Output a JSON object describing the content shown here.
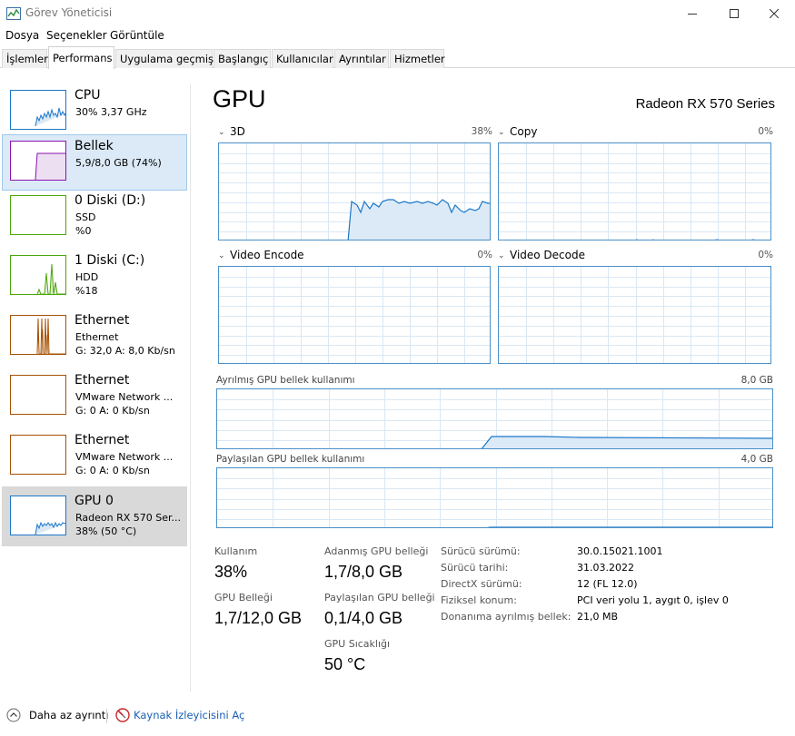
{
  "window": {
    "title": "Görev Yöneticisi"
  },
  "menu": [
    "Dosya",
    "Seçenekler",
    "Görüntüle"
  ],
  "tabs": [
    "İşlemler",
    "Performans",
    "Uygulama geçmişi",
    "Başlangıç",
    "Kullanıcılar",
    "Ayrıntılar",
    "Hizmetler"
  ],
  "sidebar": [
    {
      "name": "CPU",
      "line2": "30% 3,37 GHz",
      "line3": "",
      "color": "#1a77c9"
    },
    {
      "name": "Bellek",
      "line2": "5,9/8,0 GB (74%)",
      "line3": "",
      "color": "#8b12ae"
    },
    {
      "name": "0 Diski (D:)",
      "line2": "SSD",
      "line3": "%0",
      "color": "#4da60c"
    },
    {
      "name": "1 Diski (C:)",
      "line2": "HDD",
      "line3": "%18",
      "color": "#4da60c"
    },
    {
      "name": "Ethernet",
      "line2": "Ethernet",
      "line3": "G: 32,0  A: 8,0 Kb/sn",
      "color": "#a74f01"
    },
    {
      "name": "Ethernet",
      "line2": "VMware Network ...",
      "line3": "G: 0  A: 0 Kb/sn",
      "color": "#a74f01"
    },
    {
      "name": "Ethernet",
      "line2": "VMware Network ...",
      "line3": "G: 0  A: 0 Kb/sn",
      "color": "#a74f01"
    },
    {
      "name": "GPU 0",
      "line2": "Radeon RX 570 Ser...",
      "line3": "38% (50 °C)",
      "color": "#1a77c9"
    }
  ],
  "gpu": {
    "title": "GPU",
    "model": "Radeon RX 570 Series",
    "engines": [
      {
        "label": "3D",
        "pct": "38%"
      },
      {
        "label": "Copy",
        "pct": "0%"
      },
      {
        "label": "Video Encode",
        "pct": "0%"
      },
      {
        "label": "Video Decode",
        "pct": "0%"
      }
    ],
    "dedicated_label": "Ayrılmış GPU bellek kullanımı",
    "dedicated_max": "8,0 GB",
    "shared_label": "Paylaşılan GPU bellek kullanımı",
    "shared_max": "4,0 GB",
    "stats": {
      "usage_label": "Kullanım",
      "usage": "38%",
      "gpu_mem_label": "GPU Belleği",
      "gpu_mem": "1,7/12,0 GB",
      "dedicated_label": "Adanmış GPU belleği",
      "dedicated": "1,7/8,0 GB",
      "shared_label": "Paylaşılan GPU belleği",
      "shared": "0,1/4,0 GB",
      "temp_label": "GPU Sıcaklığı",
      "temp": "50 °C"
    },
    "info": [
      {
        "k": "Sürücü sürümü:",
        "v": "30.0.15021.1001"
      },
      {
        "k": "Sürücü tarihi:",
        "v": "31.03.2022"
      },
      {
        "k": "DirectX sürümü:",
        "v": "12 (FL 12.0)"
      },
      {
        "k": "Fiziksel konum:",
        "v": "PCI veri yolu 1, aygıt 0, işlev 0"
      },
      {
        "k": "Donanıma ayrılmış bellek:",
        "v": "21,0 MB"
      }
    ]
  },
  "footer": {
    "less_details": "Daha az ayrıntı",
    "resource_monitor": "Kaynak İzleyicisini Aç"
  },
  "colors": {
    "gpu_line": "#1a77c9",
    "graph_border": "#4a90c8",
    "graph_grid": "#d9e8f5"
  }
}
